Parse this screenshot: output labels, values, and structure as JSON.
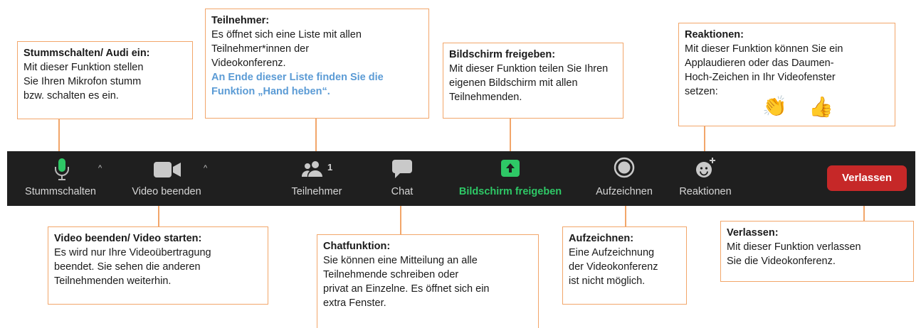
{
  "toolbar": {
    "mute_label": "Stummschalten",
    "video_label": "Video beenden",
    "participants_label": "Teilnehmer",
    "participants_count": "1",
    "chat_label": "Chat",
    "share_label": "Bildschirm freigeben",
    "record_label": "Aufzeichnen",
    "reactions_label": "Reaktionen",
    "leave_label": "Verlassen",
    "caret": "^"
  },
  "colors": {
    "toolbar_bg": "#1f1f1f",
    "share_green": "#2ec866",
    "leave_red": "#c62828",
    "callout_border": "#f2a66a",
    "highlight_blue": "#5b9bd5"
  },
  "callouts": {
    "mute": {
      "title": "Stummschalten/ Audi ein:",
      "lines": [
        "Mit dieser Funktion stellen",
        "Sie Ihren Mikrofon stumm",
        "bzw. schalten es ein."
      ]
    },
    "participants": {
      "title": "Teilnehmer:",
      "lines": [
        "Es öffnet sich eine Liste mit allen",
        "Teilnehmer*innen der",
        "Videokonferenz."
      ],
      "highlight": [
        "An Ende dieser Liste finden Sie die",
        "Funktion „Hand heben“."
      ]
    },
    "share": {
      "title": "Bildschirm freigeben:",
      "lines": [
        "Mit dieser Funktion teilen Sie Ihren",
        "eigenen Bildschirm mit allen",
        "Teilnehmenden."
      ]
    },
    "reactions": {
      "title": "Reaktionen:",
      "lines": [
        "Mit dieser Funktion können Sie ein",
        "Applaudieren oder das Daumen-",
        "Hoch-Zeichen in Ihr Videofenster",
        "setzen:"
      ],
      "emoji_clap": "👏",
      "emoji_thumbs": "👍"
    },
    "video": {
      "title": "Video beenden/ Video starten:",
      "lines": [
        "Es wird nur Ihre Videoübertragung",
        "beendet. Sie sehen die anderen",
        "Teilnehmenden weiterhin."
      ]
    },
    "chat": {
      "title": "Chatfunktion:",
      "lines": [
        "Sie können eine Mitteilung an alle",
        "Teilnehmende schreiben oder",
        "privat an Einzelne. Es öffnet sich ein",
        "extra Fenster."
      ]
    },
    "record": {
      "title": "Aufzeichnen:",
      "lines": [
        "Eine Aufzeichnung",
        "der Videokonferenz",
        "ist nicht möglich."
      ]
    },
    "leave": {
      "title": "Verlassen:",
      "lines": [
        "Mit dieser Funktion verlassen",
        "Sie die Videokonferenz."
      ]
    }
  }
}
